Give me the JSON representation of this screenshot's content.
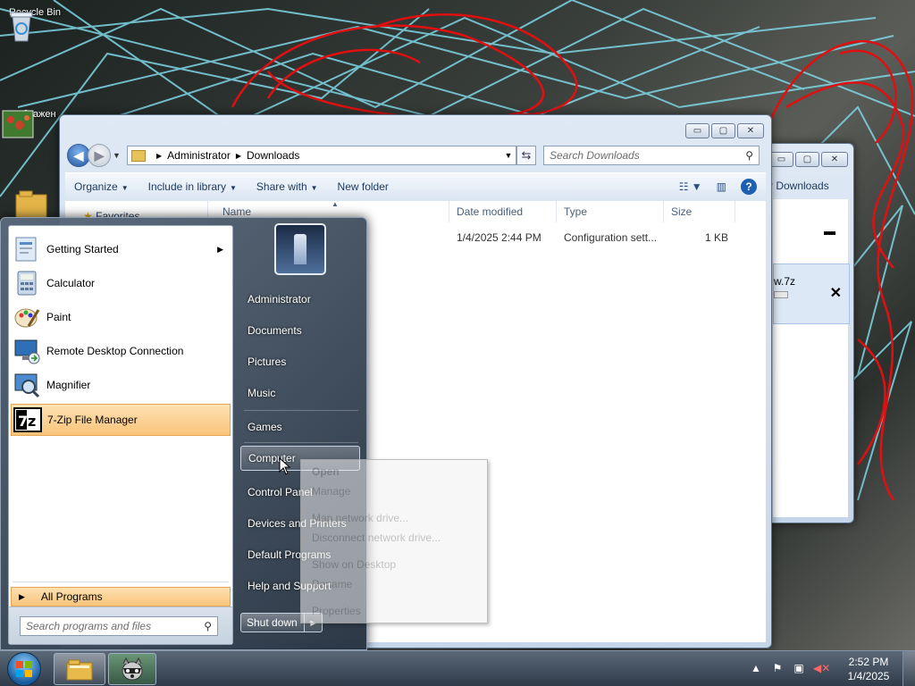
{
  "desktop": {
    "icons": [
      {
        "label": "Recycle Bin"
      },
      {
        "label": "изображен"
      }
    ]
  },
  "explorer": {
    "address": [
      "Administrator",
      "Downloads"
    ],
    "search_placeholder": "Search Downloads",
    "toolbar": {
      "organize": "Organize",
      "include_in_library": "Include in library",
      "share_with": "Share with",
      "new_folder": "New folder"
    },
    "navpane": {
      "favorites": "Favorites"
    },
    "columns": [
      "Name",
      "Date modified",
      "Type",
      "Size"
    ],
    "rows": [
      {
        "name": "",
        "date": "1/4/2025 2:44 PM",
        "type": "Configuration sett...",
        "size": "1 KB"
      }
    ]
  },
  "back_window": {
    "title_fragment": "r Downloads",
    "item_fragment": "w.7z"
  },
  "start_menu": {
    "programs": [
      {
        "label": "Getting Started",
        "has_submenu": true,
        "icon": "getting-started-icon"
      },
      {
        "label": "Calculator",
        "icon": "calculator-icon"
      },
      {
        "label": "Paint",
        "icon": "paint-icon"
      },
      {
        "label": "Remote Desktop Connection",
        "icon": "remote-desktop-icon"
      },
      {
        "label": "Magnifier",
        "icon": "magnifier-icon"
      },
      {
        "label": "7-Zip File Manager",
        "icon": "7zip-icon",
        "highlighted": true
      }
    ],
    "all_programs": "All Programs",
    "search_placeholder": "Search programs and files",
    "right_links": [
      {
        "label": "Administrator"
      },
      {
        "label": "Documents"
      },
      {
        "label": "Pictures"
      },
      {
        "label": "Music"
      },
      {
        "label": "Games"
      },
      {
        "label": "Computer",
        "selected": true
      },
      {
        "label": "Control Panel"
      },
      {
        "label": "Devices and Printers"
      },
      {
        "label": "Default Programs"
      },
      {
        "label": "Help and Support"
      }
    ],
    "shutdown": "Shut down"
  },
  "context_menu": {
    "items": [
      {
        "label": "Open",
        "bold": true
      },
      {
        "label": "Manage"
      },
      {
        "label": "Map network drive..."
      },
      {
        "label": "Disconnect network drive..."
      },
      {
        "label": "Show on Desktop"
      },
      {
        "label": "Rename"
      },
      {
        "label": "Properties"
      }
    ]
  },
  "taskbar": {
    "clock_time": "2:52 PM",
    "clock_date": "1/4/2025"
  },
  "colors": {
    "highlight": "#f9c47b",
    "wallpaper_cyan": "#7fd6e6",
    "wallpaper_red": "#e01010"
  }
}
